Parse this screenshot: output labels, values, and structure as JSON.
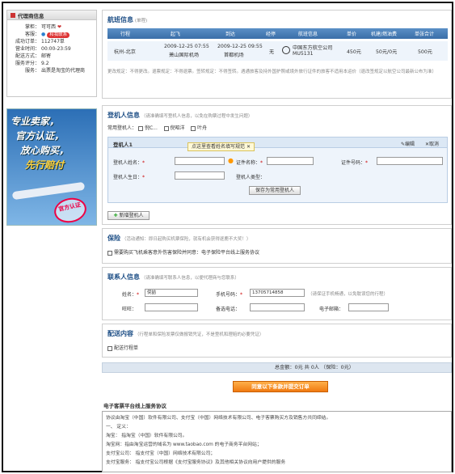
{
  "agent": {
    "header": "代理商信息",
    "rows": [
      {
        "k": "掌柜：",
        "v": "可可西"
      },
      {
        "k": "客服：",
        "v": "和我联系"
      },
      {
        "k": "成功订单：",
        "v": "112747单"
      },
      {
        "k": "营业时间：",
        "v": "00:00-23:59"
      },
      {
        "k": "配送方式：",
        "v": "邮寄"
      },
      {
        "k": "服务评分：",
        "v": "9.2"
      },
      {
        "k": "服务：",
        "v": "出票是淘宝的代理商"
      }
    ]
  },
  "ad": {
    "lines": [
      "专业卖家，",
      "官方认证，",
      "放心购买，",
      "先行赔付"
    ],
    "stamp": "官方认证"
  },
  "flight": {
    "title": "航班信息",
    "title_note": "(单程)",
    "headers": [
      "行程",
      "起飞",
      "到达",
      "经停",
      "航班信息",
      "单价",
      "机建/燃油费",
      "单张合计"
    ],
    "row": {
      "route": "杭州-北京",
      "dep_time": "2009-12-25 07:55",
      "dep_airport": "萧山国际机场",
      "arr_time": "2009-12-25 09:55",
      "arr_airport": "首都机场",
      "stop": "无",
      "airline": "中国东方航空公司",
      "flight_no": "MU5131",
      "price": "450元",
      "tax": "50元/0元",
      "total": "500元"
    },
    "note": "更改规定：不得更改。退票规定：不得退票。签转规定：不得签转。遇通旅客及持外国护照或境外旅行证件的旅客不适用本运价（退改签规定以航空公司最新公布为准）"
  },
  "passenger": {
    "title": "登机人信息",
    "hint": "（请准确填写登机人信息，以免在购票过程中发生问题）",
    "common_label": "常用登机人：",
    "common": [
      "倪C...",
      "倪昭洋",
      "叶舟"
    ],
    "card_title": "登机人1",
    "edit": "编辑",
    "cancel": "取消",
    "name_label": "登机人姓名：",
    "cert_name_label": "证件名称：",
    "cert_no_label": "证件号码：",
    "birthday_label": "登机人生日：",
    "type_label": "登机人类型：",
    "save_button": "保存为常用登机人",
    "tip": "点这里查看姓名填写规范",
    "add_button": "新增登机人"
  },
  "insurance": {
    "title": "保险",
    "hint": "（活动通知：即日起购买机票保险，就有机会获得逐鹿不大奖！）",
    "check_label": "需要购买飞机乘客意外伤害保险并同意：电子保险平台线上服务协议"
  },
  "contact": {
    "title": "联系人信息",
    "hint": "（请准确填写联系人信息，以便代理商与您联系）",
    "name_label": "姓名：",
    "name_value": "倪喆",
    "phone_label": "手机号码：",
    "phone_value": "13705714858",
    "phone_hint": "（请保证手机畅通，以免耽误您的行程）",
    "wangwang_label": "旺旺：",
    "backup_phone_label": "备选电话：",
    "email_label": "电子邮箱："
  },
  "delivery": {
    "title": "配送内容",
    "hint": "（行程单和保险发票仅做报销凭证，不是登机和理赔的必要凭证）",
    "check_label": "配送行程单"
  },
  "total": {
    "text": "总金额：0元 共 0人 （保险：0元）"
  },
  "submit_label": "同意以下条款并提交订单",
  "agreement": {
    "title": "电子客票平台线上服务协议",
    "lines": [
      "协议由淘宝（中国）软件有限公司、支付宝（中国）网络技术有限公司、电子客票购买方及销售方共同缔结。",
      "一、  定义：",
      "淘宝：  指淘宝（中国）软件有限公司。",
      "淘宝网：指由淘宝运营的域名为 www.taobao.com 的电子商务平台网站；",
      "支付宝公司：  指支付宝（中国）网络技术有限公司；",
      "支付宝服务：  指支付宝公司根据《支付宝服务协议》及其他相关协议向用户提供的服务"
    ]
  },
  "colors": {
    "accent_blue": "#3a6ea8",
    "title_blue": "#1e4f86",
    "submit_orange": "#f07a10"
  }
}
